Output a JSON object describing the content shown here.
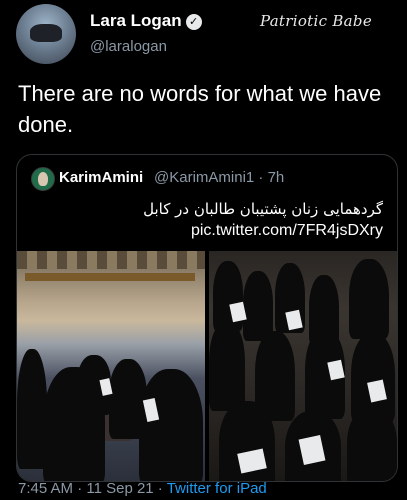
{
  "author": {
    "name": "Lara Logan",
    "handle": "@laralogan"
  },
  "watermark": "Patriotic Babe",
  "tweet_text": "There are no words for what we have done.",
  "quoted": {
    "name": "KarimAmini",
    "handle": "@KarimAmini1 · 7h",
    "text": "گردهمایی زنان پشتیبان طالبان در کابل",
    "link": "pic.twitter.com/7FR4jsDXry"
  },
  "meta": {
    "time_date": "7:45 AM · 11 Sep 21 · ",
    "source": "Twitter for iPad"
  },
  "icons": {
    "verified": "verified-check-icon"
  },
  "colors": {
    "background": "#000000",
    "muted": "#8b98a5",
    "link": "#1d9bf0",
    "border": "#2f3336"
  }
}
